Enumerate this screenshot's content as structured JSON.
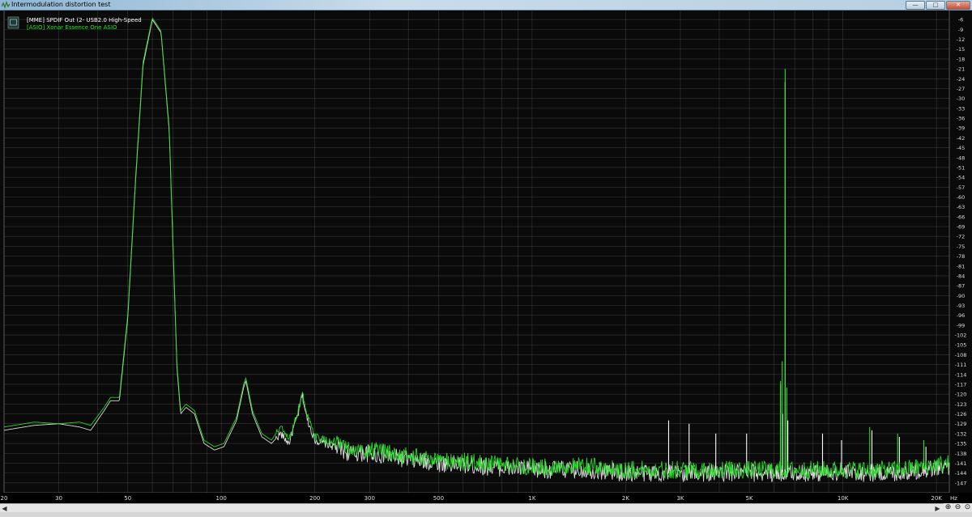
{
  "window": {
    "title": "Intermodulation distortion test",
    "minimize_icon": "minimize-icon",
    "maximize_icon": "maximize-icon",
    "close_icon": "close-icon",
    "app_icon": "waveform-app-icon"
  },
  "legend": {
    "icon": "legend-settings-icon",
    "entries": [
      {
        "label": "[MME] SPDIF Out (2- USB2.0 High-Speed",
        "color": "#ffffff"
      },
      {
        "label": "[ASIO] Xonar Essence One ASIO",
        "color": "#27e027"
      }
    ]
  },
  "colors": {
    "background": "#0a0a0a",
    "grid": "#5a5a5a",
    "series1": "#ffffff",
    "series2": "#27e027"
  },
  "chart_data": {
    "type": "line",
    "xscale": "log",
    "xlim": [
      20,
      22000
    ],
    "ylim": [
      -150,
      -3
    ],
    "xunit": "Hz",
    "grid": true,
    "legend_position": "top-left",
    "x_ticks": [
      {
        "v": 20,
        "l": "20"
      },
      {
        "v": 30,
        "l": "30"
      },
      {
        "v": 50,
        "l": "50"
      },
      {
        "v": 100,
        "l": "100"
      },
      {
        "v": 200,
        "l": "200"
      },
      {
        "v": 300,
        "l": "300"
      },
      {
        "v": 500,
        "l": "500"
      },
      {
        "v": 1000,
        "l": "1K"
      },
      {
        "v": 2000,
        "l": "2K"
      },
      {
        "v": 3000,
        "l": "3K"
      },
      {
        "v": 5000,
        "l": "5K"
      },
      {
        "v": 10000,
        "l": "10K"
      },
      {
        "v": 20000,
        "l": "20K"
      }
    ],
    "y_ticks": [
      -6,
      -9,
      -12,
      -15,
      -18,
      -21,
      -24,
      -27,
      -30,
      -33,
      -36,
      -39,
      -42,
      -45,
      -48,
      -51,
      -54,
      -57,
      -60,
      -63,
      -66,
      -69,
      -72,
      -75,
      -78,
      -81,
      -84,
      -87,
      -90,
      -93,
      -96,
      -99,
      -102,
      -105,
      -108,
      -111,
      -114,
      -117,
      -120,
      -123,
      -126,
      -129,
      -132,
      -135,
      -138,
      -141,
      -144,
      -147
    ],
    "series": [
      {
        "name": "[MME] SPDIF Out (2- USB2.0 High-Speed",
        "color": "#ffffff",
        "points": [
          [
            20,
            -131
          ],
          [
            25,
            -129.5
          ],
          [
            30,
            -129
          ],
          [
            35,
            -130
          ],
          [
            38,
            -131
          ],
          [
            42,
            -125
          ],
          [
            44,
            -122
          ],
          [
            47,
            -122
          ],
          [
            50,
            -97
          ],
          [
            53,
            -55
          ],
          [
            56,
            -20
          ],
          [
            60,
            -6
          ],
          [
            64,
            -10
          ],
          [
            68,
            -40
          ],
          [
            72,
            -112
          ],
          [
            74,
            -126
          ],
          [
            77,
            -124
          ],
          [
            82,
            -126
          ],
          [
            88,
            -135
          ],
          [
            95,
            -137
          ],
          [
            102,
            -136
          ],
          [
            112,
            -128
          ],
          [
            118,
            -118
          ],
          [
            120,
            -116
          ],
          [
            126,
            -126
          ],
          [
            135,
            -133
          ],
          [
            145,
            -135
          ],
          [
            155,
            -132
          ],
          [
            165,
            -135
          ],
          [
            178,
            -125
          ],
          [
            182,
            -120
          ],
          [
            188,
            -127
          ],
          [
            200,
            -134
          ],
          [
            215,
            -135
          ],
          [
            230,
            -136
          ],
          [
            260,
            -138
          ],
          [
            300,
            -138
          ],
          [
            400,
            -140
          ],
          [
            500,
            -141
          ],
          [
            700,
            -142
          ],
          [
            1000,
            -143
          ],
          [
            1500,
            -143
          ],
          [
            2000,
            -144
          ],
          [
            3000,
            -144
          ],
          [
            4000,
            -144
          ],
          [
            5000,
            -144
          ],
          [
            6000,
            -144
          ],
          [
            8000,
            -144
          ],
          [
            10000,
            -144
          ],
          [
            15000,
            -144
          ],
          [
            22000,
            -142
          ]
        ],
        "spikes": [
          [
            2750,
            -128
          ],
          [
            3200,
            -129
          ],
          [
            3900,
            -132
          ],
          [
            4900,
            -132
          ],
          [
            6300,
            -117
          ],
          [
            6400,
            -126
          ],
          [
            6520,
            -25
          ],
          [
            6650,
            -128
          ],
          [
            8600,
            -132
          ],
          [
            9900,
            -134
          ],
          [
            12400,
            -131
          ],
          [
            15200,
            -133
          ],
          [
            18500,
            -136
          ]
        ]
      },
      {
        "name": "[ASIO] Xonar Essence One ASIO",
        "color": "#27e027",
        "points": [
          [
            20,
            -130
          ],
          [
            25,
            -128.5
          ],
          [
            30,
            -129
          ],
          [
            35,
            -128.5
          ],
          [
            38,
            -129.5
          ],
          [
            42,
            -124
          ],
          [
            44,
            -121
          ],
          [
            47,
            -121
          ],
          [
            50,
            -96
          ],
          [
            53,
            -54
          ],
          [
            56,
            -19
          ],
          [
            60,
            -5.5
          ],
          [
            64,
            -9.5
          ],
          [
            68,
            -39
          ],
          [
            72,
            -111
          ],
          [
            74,
            -125
          ],
          [
            77,
            -123
          ],
          [
            82,
            -125
          ],
          [
            88,
            -134
          ],
          [
            95,
            -136
          ],
          [
            102,
            -135
          ],
          [
            112,
            -127
          ],
          [
            118,
            -117
          ],
          [
            120,
            -115
          ],
          [
            126,
            -125
          ],
          [
            135,
            -132
          ],
          [
            145,
            -134
          ],
          [
            155,
            -130
          ],
          [
            165,
            -134
          ],
          [
            178,
            -124
          ],
          [
            182,
            -119
          ],
          [
            188,
            -126
          ],
          [
            200,
            -133
          ],
          [
            215,
            -134
          ],
          [
            230,
            -135
          ],
          [
            260,
            -137
          ],
          [
            300,
            -137
          ],
          [
            400,
            -139
          ],
          [
            500,
            -140
          ],
          [
            700,
            -141
          ],
          [
            1000,
            -142
          ],
          [
            1500,
            -142
          ],
          [
            2000,
            -143
          ],
          [
            3000,
            -143
          ],
          [
            4000,
            -143
          ],
          [
            5000,
            -143
          ],
          [
            6000,
            -143
          ],
          [
            8000,
            -143
          ],
          [
            10000,
            -143
          ],
          [
            15000,
            -143
          ],
          [
            22000,
            -141
          ]
        ],
        "spikes": [
          [
            6300,
            -116
          ],
          [
            6380,
            -110
          ],
          [
            6520,
            -21
          ],
          [
            6600,
            -118
          ],
          [
            12200,
            -130
          ],
          [
            15000,
            -132
          ],
          [
            18200,
            -134
          ]
        ]
      }
    ]
  }
}
